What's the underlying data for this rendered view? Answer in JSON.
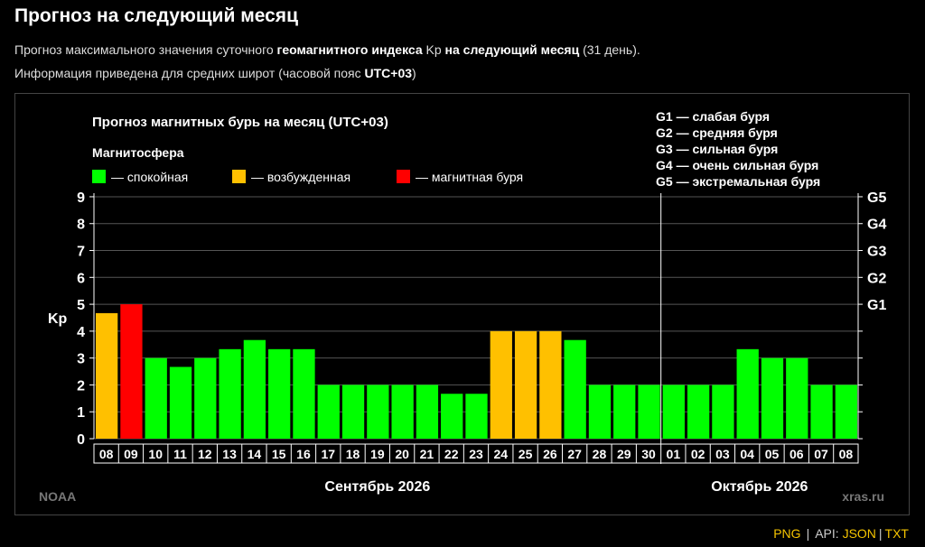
{
  "page": {
    "title": "Прогноз на следующий месяц",
    "info1": {
      "p1": "Прогноз максимального значения суточного ",
      "b1": "геомагнитного индекса",
      "p2": " Kp ",
      "b2": "на следующий месяц",
      "p3": " (31 день)."
    },
    "info2": {
      "p1": "Информация приведена для средних широт (часовой пояс ",
      "b1": "UTC+03",
      "p2": ")"
    }
  },
  "chart_data": {
    "type": "bar",
    "title": "Прогноз магнитных бурь на месяц (UTC+03)",
    "legend_title": "Магнитосфера",
    "legend": [
      {
        "key": "quiet",
        "label": "— спокойная",
        "color": "#00ff00"
      },
      {
        "key": "excited",
        "label": "— возбужденная",
        "color": "#ffc000"
      },
      {
        "key": "storm",
        "label": "— магнитная буря",
        "color": "#ff0000"
      }
    ],
    "storm_scale": [
      "G1 — слабая буря",
      "G2 — средняя буря",
      "G3 — сильная буря",
      "G4 — очень сильная буря",
      "G5 — экстремальная буря"
    ],
    "ylabel": "Kp",
    "ylim": [
      0,
      9
    ],
    "y_ticks": [
      0,
      1,
      2,
      3,
      4,
      5,
      6,
      7,
      8,
      9
    ],
    "right_ticks": [
      {
        "value": 5,
        "label": "G1"
      },
      {
        "value": 6,
        "label": "G2"
      },
      {
        "value": 7,
        "label": "G3"
      },
      {
        "value": 8,
        "label": "G4"
      },
      {
        "value": 9,
        "label": "G5"
      }
    ],
    "categories": [
      "08",
      "09",
      "10",
      "11",
      "12",
      "13",
      "14",
      "15",
      "16",
      "17",
      "18",
      "19",
      "20",
      "21",
      "22",
      "23",
      "24",
      "25",
      "26",
      "27",
      "28",
      "29",
      "30",
      "01",
      "02",
      "03",
      "04",
      "05",
      "06",
      "07",
      "08"
    ],
    "values": [
      4.67,
      5,
      3,
      2.67,
      3,
      3.33,
      3.67,
      3.33,
      3.33,
      2,
      2,
      2,
      2,
      2,
      1.67,
      1.67,
      4,
      4,
      4,
      3.67,
      2,
      2,
      2,
      2,
      2,
      2,
      3.33,
      3,
      3,
      2,
      2
    ],
    "levels": [
      "excited",
      "storm",
      "quiet",
      "quiet",
      "quiet",
      "quiet",
      "quiet",
      "quiet",
      "quiet",
      "quiet",
      "quiet",
      "quiet",
      "quiet",
      "quiet",
      "quiet",
      "quiet",
      "excited",
      "excited",
      "excited",
      "quiet",
      "quiet",
      "quiet",
      "quiet",
      "quiet",
      "quiet",
      "quiet",
      "quiet",
      "quiet",
      "quiet",
      "quiet",
      "quiet"
    ],
    "months": [
      {
        "label": "Сентябрь 2026",
        "days": 23
      },
      {
        "label": "Октябрь 2026",
        "days": 8
      }
    ],
    "source": "NOAA",
    "watermark": "xras.ru"
  },
  "footer": {
    "png": "PNG",
    "api": "API:",
    "json": "JSON",
    "sep": "|",
    "txt": "TXT"
  }
}
